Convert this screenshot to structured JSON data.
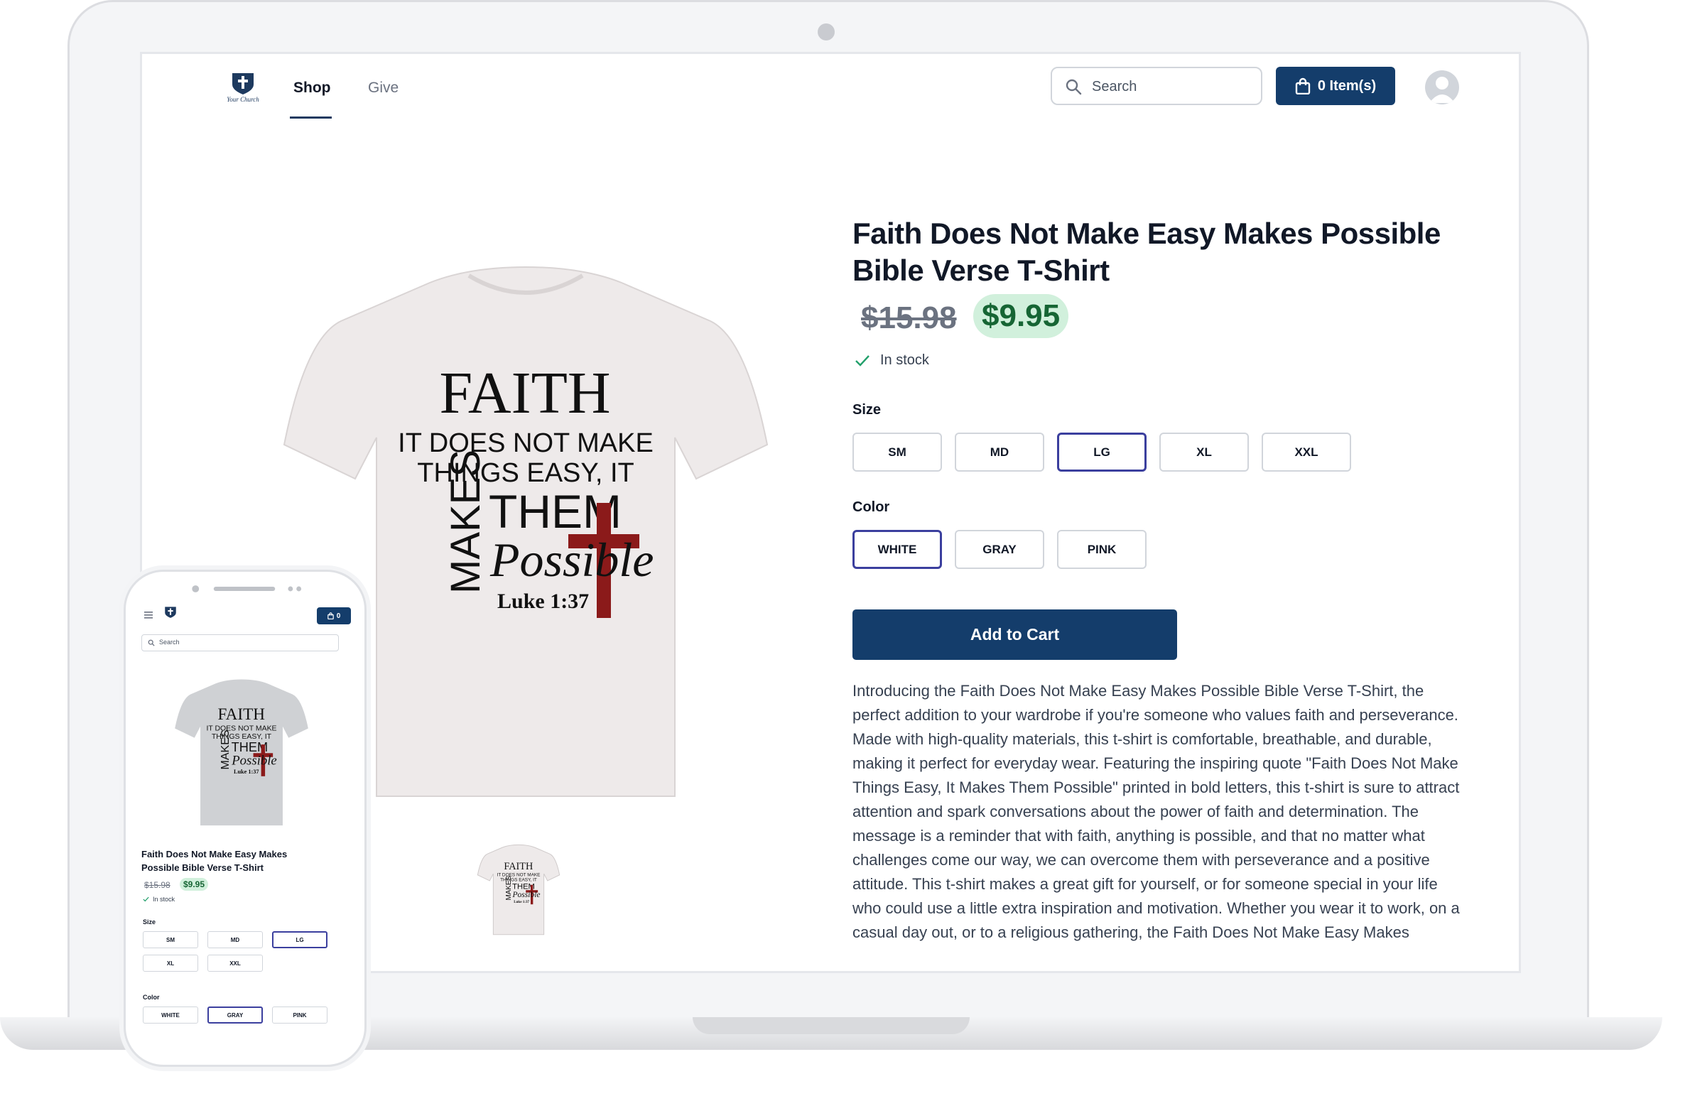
{
  "header": {
    "nav": [
      {
        "label": "Shop"
      },
      {
        "label": "Give"
      }
    ],
    "search_placeholder": "Search",
    "cart_label": "0 Item(s)"
  },
  "product": {
    "title": "Faith Does Not Make Easy Makes Possible Bible Verse T-Shirt",
    "price_original": "$15.98",
    "price_sale": "$9.95",
    "stock": "In stock",
    "size_label": "Size",
    "sizes": [
      "SM",
      "MD",
      "LG",
      "XL",
      "XXL"
    ],
    "selected_size": "LG",
    "color_label": "Color",
    "colors": [
      "WHITE",
      "GRAY",
      "PINK"
    ],
    "selected_color": "WHITE",
    "add_to_cart": "Add to Cart",
    "description": "Introducing the Faith Does Not Make Easy Makes Possible Bible Verse T-Shirt, the perfect addition to your wardrobe if you're someone who values faith and perseverance. Made with high-quality materials, this t-shirt is comfortable, breathable, and durable, making it perfect for everyday wear. Featuring the inspiring quote \"Faith Does Not Make Things Easy, It Makes Them Possible\" printed in bold letters, this t-shirt is sure to attract attention and spark conversations about the power of faith and determination. The message is a reminder that with faith, anything is possible, and that no matter what challenges come our way, we can overcome them with perseverance and a positive attitude. This t-shirt makes a great gift for yourself, or for someone special in your life who could use a little extra inspiration and motivation. Whether you wear it to work, on a casual day out, or to a religious gathering, the Faith Does Not Make Easy Makes"
  },
  "shirt_print": {
    "line1": "FAITH",
    "line2": "IT DOES NOT MAKE",
    "line3": "THINGS EASY, IT",
    "makes": "MAKES",
    "them": "THEM",
    "possible": "Possible",
    "verse": "Luke 1:37"
  },
  "logo_text": "Your Church",
  "mobile": {
    "cart_count": "0",
    "search_placeholder": "Search",
    "title": "Faith Does Not Make Easy Makes Possible Bible Verse T-Shirt",
    "price_original": "$15.98",
    "price_sale": "$9.95",
    "stock": "In stock",
    "size_label": "Size",
    "sizes": [
      "SM",
      "MD",
      "LG",
      "XL",
      "XXL"
    ],
    "selected_size": "LG",
    "color_label": "Color",
    "colors": [
      "WHITE",
      "GRAY",
      "PINK"
    ],
    "selected_color": "GRAY"
  },
  "colors": {
    "brand": "#143d6b",
    "sale_bg": "#d1f0dc",
    "sale_text": "#166534",
    "selected_border": "#3b3f9e",
    "cross": "#8b1a1a"
  }
}
